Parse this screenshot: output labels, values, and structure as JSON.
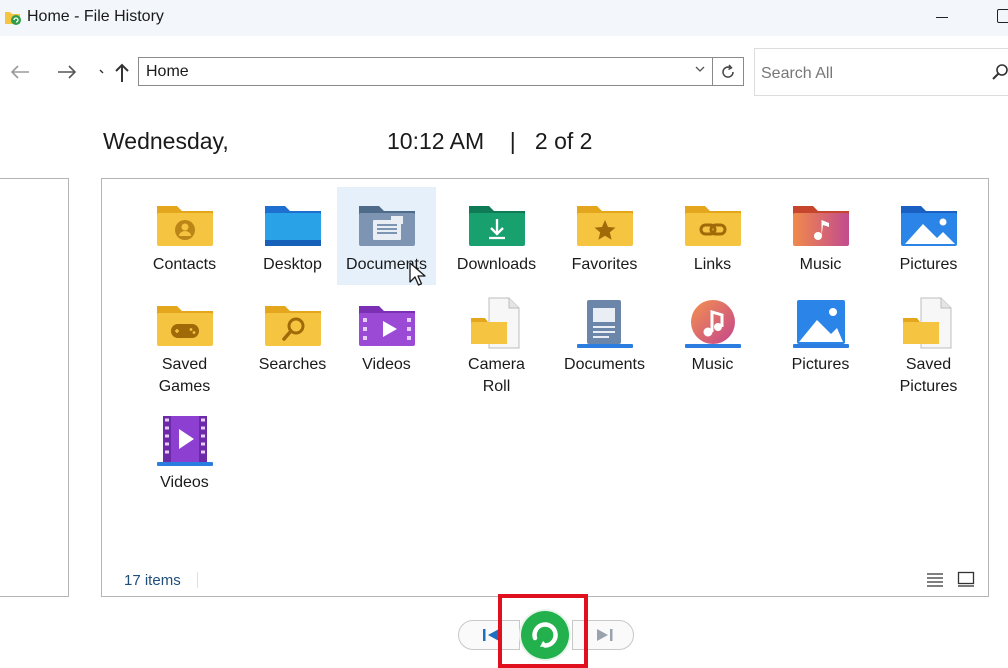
{
  "window": {
    "title": "Home - File History",
    "title_icon": "file-history-icon"
  },
  "navigation": {
    "back_icon": "arrow-left-icon",
    "forward_icon": "arrow-right-icon",
    "recent_icon": "chevron-down-icon",
    "up_icon": "arrow-up-icon",
    "address": "Home",
    "refresh_icon": "refresh-icon",
    "search_placeholder": "Search All",
    "search_icon": "search-icon"
  },
  "snapshot": {
    "date": "Wednesday,",
    "time_and_page": "10:12 AM    |   2 of 2"
  },
  "items": [
    {
      "name": "Contacts",
      "icon": "contacts-folder-icon"
    },
    {
      "name": "Desktop",
      "icon": "desktop-folder-icon"
    },
    {
      "name": "Documents",
      "icon": "documents-folder-icon",
      "selected": true
    },
    {
      "name": "Downloads",
      "icon": "downloads-folder-icon"
    },
    {
      "name": "Favorites",
      "icon": "favorites-folder-icon"
    },
    {
      "name": "Links",
      "icon": "links-folder-icon"
    },
    {
      "name": "Music",
      "icon": "music-folder-icon"
    },
    {
      "name": "Pictures",
      "icon": "pictures-folder-icon"
    },
    {
      "name": "Saved\nGames",
      "icon": "saved-games-folder-icon"
    },
    {
      "name": "Searches",
      "icon": "searches-folder-icon"
    },
    {
      "name": "Videos",
      "icon": "videos-folder-icon"
    },
    {
      "name": "Camera\nRoll",
      "icon": "camera-roll-folder-icon"
    },
    {
      "name": "Documents",
      "icon": "documents-library-icon"
    },
    {
      "name": "Music",
      "icon": "music-library-icon"
    },
    {
      "name": "Pictures",
      "icon": "pictures-library-icon"
    },
    {
      "name": "Saved\nPictures",
      "icon": "saved-pictures-folder-icon"
    },
    {
      "name": "Videos",
      "icon": "videos-library-icon"
    }
  ],
  "status": {
    "count": "17 items"
  },
  "playback": {
    "previous_icon": "previous-version-icon",
    "restore_icon": "restore-icon",
    "next_icon": "next-version-icon"
  },
  "colors": {
    "folder_yellow": "#f5c441",
    "selection": "#e5f0fb",
    "restore_green": "#22b14c",
    "highlight_red": "#e0101e"
  }
}
